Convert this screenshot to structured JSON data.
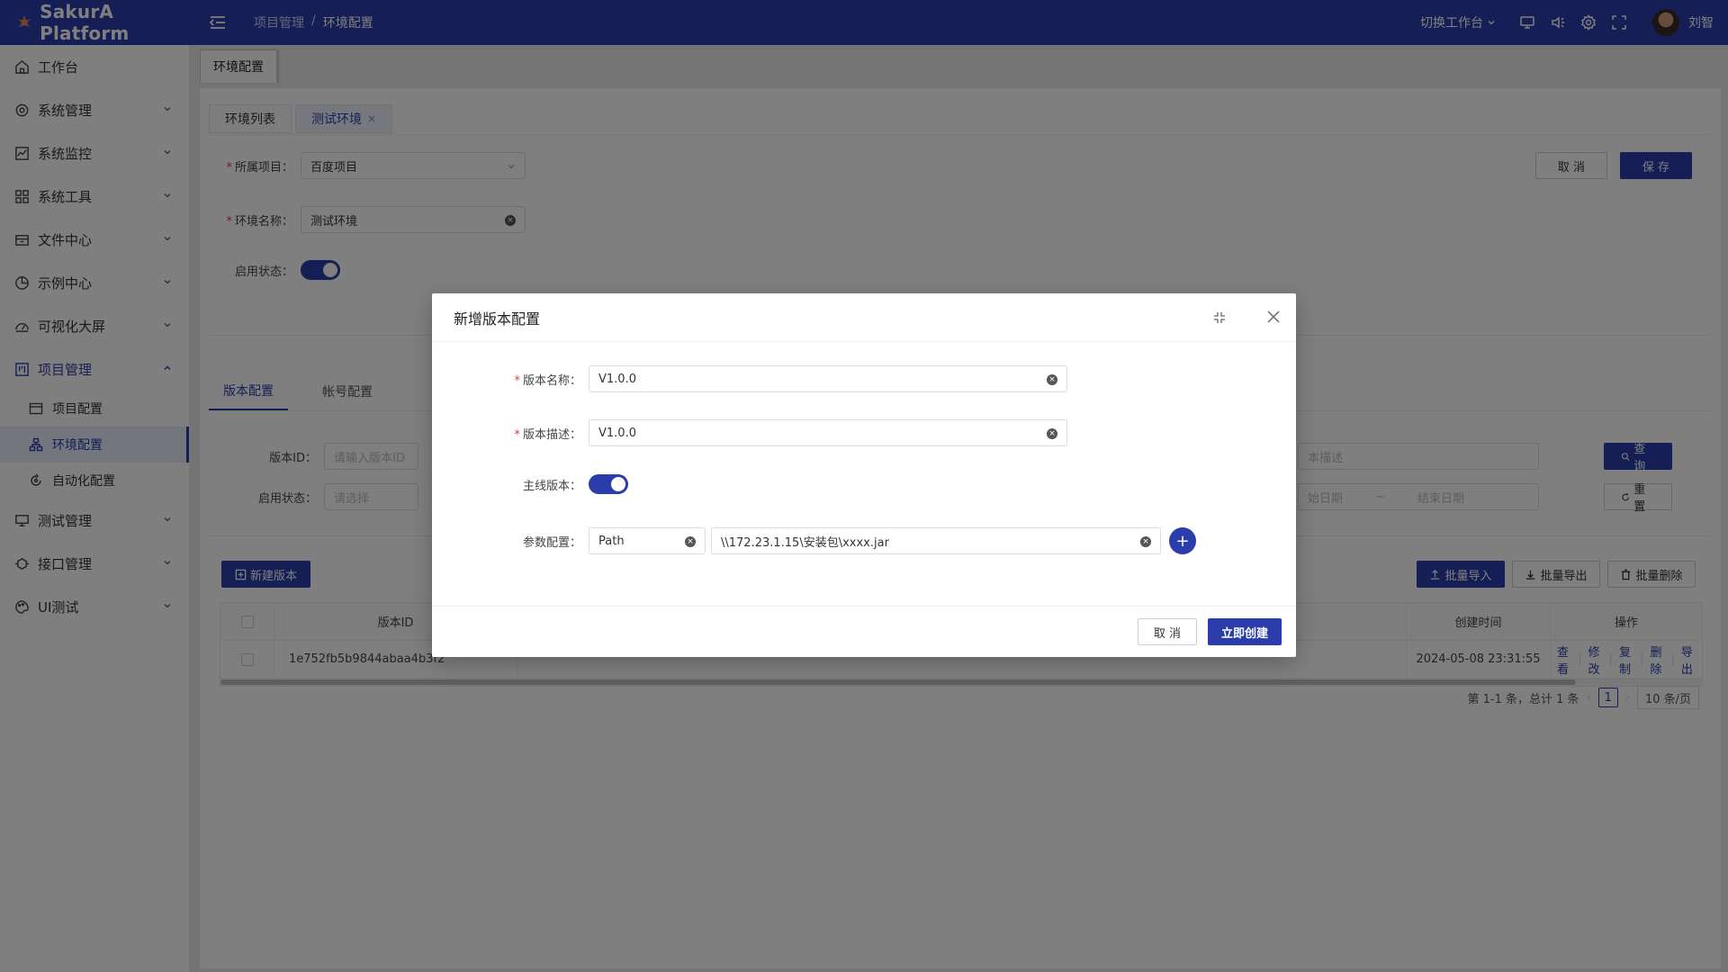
{
  "header": {
    "app_name": "SakurA Platform",
    "breadcrumb": [
      "项目管理",
      "环境配置"
    ],
    "breadcrumb_sep": "/",
    "switch_workspace": "切换工作台",
    "username": "刘智",
    "brand_color": "#2a3daa"
  },
  "sidebar": {
    "items": [
      {
        "label": "工作台",
        "icon": "home-icon"
      },
      {
        "label": "系统管理",
        "icon": "gear-icon"
      },
      {
        "label": "系统监控",
        "icon": "chart-icon"
      },
      {
        "label": "系统工具",
        "icon": "grid-icon"
      },
      {
        "label": "文件中心",
        "icon": "folder-icon"
      },
      {
        "label": "示例中心",
        "icon": "pie-icon"
      },
      {
        "label": "可视化大屏",
        "icon": "dashboard-icon"
      },
      {
        "label": "项目管理",
        "icon": "project-icon"
      },
      {
        "label": "测试管理",
        "icon": "monitor-icon"
      },
      {
        "label": "接口管理",
        "icon": "api-icon"
      },
      {
        "label": "UI测试",
        "icon": "palette-icon"
      }
    ],
    "sub_items": [
      {
        "label": "项目配置",
        "icon": "card-icon"
      },
      {
        "label": "环境配置",
        "icon": "tree-icon"
      },
      {
        "label": "自动化配置",
        "icon": "refresh-icon"
      }
    ]
  },
  "page_tab": "环境配置",
  "inner_tabs": {
    "list": "环境列表",
    "current": "测试环境",
    "close": "×"
  },
  "env_form": {
    "project_label": "所属项目：",
    "project_value": "百度项目",
    "name_label": "环境名称：",
    "name_value": "测试环境",
    "status_label": "启用状态：",
    "cancel": "取 消",
    "save": "保 存"
  },
  "section_tabs": {
    "version": "版本配置",
    "account": "帐号配置"
  },
  "filters": {
    "version_id_label": "版本ID：",
    "version_id_placeholder": "请输入版本ID",
    "status_label": "启用状态：",
    "status_placeholder": "请选择",
    "desc_placeholder": "本描述",
    "start_date": "始日期",
    "date_sep": "~",
    "end_date": "结束日期",
    "query": "查 询",
    "reset": "重 置"
  },
  "actions": {
    "new_version": "新建版本",
    "batch_import": "批量导入",
    "batch_export": "批量导出",
    "batch_delete": "批量删除"
  },
  "table": {
    "columns": {
      "version_id": "版本ID",
      "created": "创建时间",
      "ops": "操作"
    },
    "rows": [
      {
        "version_id": "1e752fb5b9844abaa4b3f2",
        "created": "2024-05-08 23:31:55"
      }
    ],
    "ops": [
      "查看",
      "修改",
      "复制",
      "删除",
      "导出"
    ]
  },
  "pagination": {
    "summary": "第 1-1 条，总计 1 条",
    "current_page": "1",
    "page_size": "10 条/页"
  },
  "modal": {
    "title": "新增版本配置",
    "version_name_label": "版本名称：",
    "version_name_value": "V1.0.0",
    "version_desc_label": "版本描述：",
    "version_desc_value": "V1.0.0",
    "mainline_label": "主线版本：",
    "param_label": "参数配置：",
    "param_key": "Path",
    "param_value": "\\\\172.23.1.15\\安装包\\xxxx.jar",
    "cancel": "取 消",
    "create": "立即创建"
  }
}
